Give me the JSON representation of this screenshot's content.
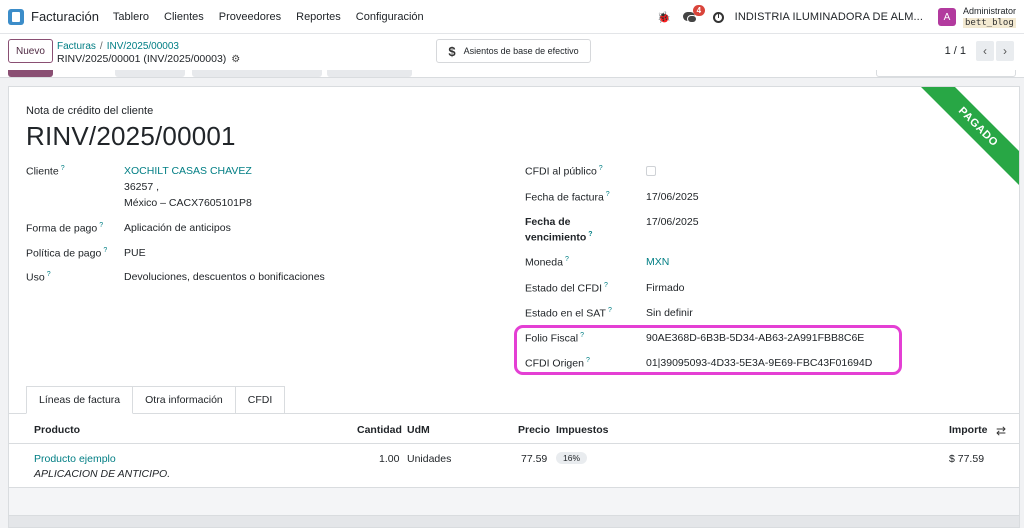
{
  "nav": {
    "app_name": "Facturación",
    "menu": [
      "Tablero",
      "Clientes",
      "Proveedores",
      "Reportes",
      "Configuración"
    ],
    "chat_badge": "4",
    "company": "INDISTRIA ILUMINADORA DE ALM...",
    "avatar_letter": "A",
    "user_name": "Administrator",
    "db_name": "bett_blog"
  },
  "control": {
    "new_button": "Nuevo",
    "breadcrumb_root": "Facturas",
    "breadcrumb_sep": "/",
    "breadcrumb_parent": "INV/2025/00003",
    "breadcrumb_current": "RINV/2025/00001 (INV/2025/00003)",
    "cash_basis_button": "Asientos de base de efectivo",
    "pager_value": "1 / 1"
  },
  "sheet": {
    "status_ribbon": "PAGADO",
    "doc_type": "Nota de crédito del cliente",
    "doc_name": "RINV/2025/00001"
  },
  "left_fields": {
    "cliente_label": "Cliente",
    "cliente_name": "XOCHILT CASAS CHAVEZ",
    "cliente_addr1": "36257 ,",
    "cliente_addr2": "México – CACX7605101P8",
    "forma_pago_label": "Forma de pago",
    "forma_pago_value": "Aplicación de anticipos",
    "politica_label": "Política de pago",
    "politica_value": "PUE",
    "uso_label": "Uso",
    "uso_value": "Devoluciones, descuentos o bonificaciones"
  },
  "right_fields": {
    "cfdi_publico_label": "CFDI al público",
    "fecha_factura_label": "Fecha de factura",
    "fecha_factura_value": "17/06/2025",
    "vencimiento_label_1": "Fecha de",
    "vencimiento_label_2": "vencimiento",
    "vencimiento_value": "17/06/2025",
    "moneda_label": "Moneda",
    "moneda_value": "MXN",
    "estado_cfdi_label": "Estado del CFDI",
    "estado_cfdi_value": "Firmado",
    "estado_sat_label": "Estado en el SAT",
    "estado_sat_value": "Sin definir",
    "folio_label": "Folio Fiscal",
    "folio_value": "90AE368D-6B3B-5D34-AB63-2A991FBB8C6E",
    "cfdi_origen_label": "CFDI Origen",
    "cfdi_origen_value": "01|39095093-4D33-5E3A-9E69-FBC43F01694D",
    "help_mark": "?"
  },
  "tabs": [
    "Líneas de factura",
    "Otra información",
    "CFDI"
  ],
  "lines": {
    "headers": {
      "product": "Producto",
      "qty": "Cantidad",
      "uom": "UdM",
      "price": "Precio",
      "taxes": "Impuestos",
      "amount": "Importe"
    },
    "rows": [
      {
        "product": "Producto ejemplo",
        "description": "APLICACION DE ANTICIPO.",
        "qty": "1.00",
        "uom": "Unidades",
        "price": "77.59",
        "tax": "16%",
        "amount": "$ 77.59"
      }
    ]
  },
  "colors": {
    "accent": "#017e84",
    "ribbon": "#28a745",
    "highlight": "#e43fd4",
    "new_button": "#8a4f73"
  }
}
